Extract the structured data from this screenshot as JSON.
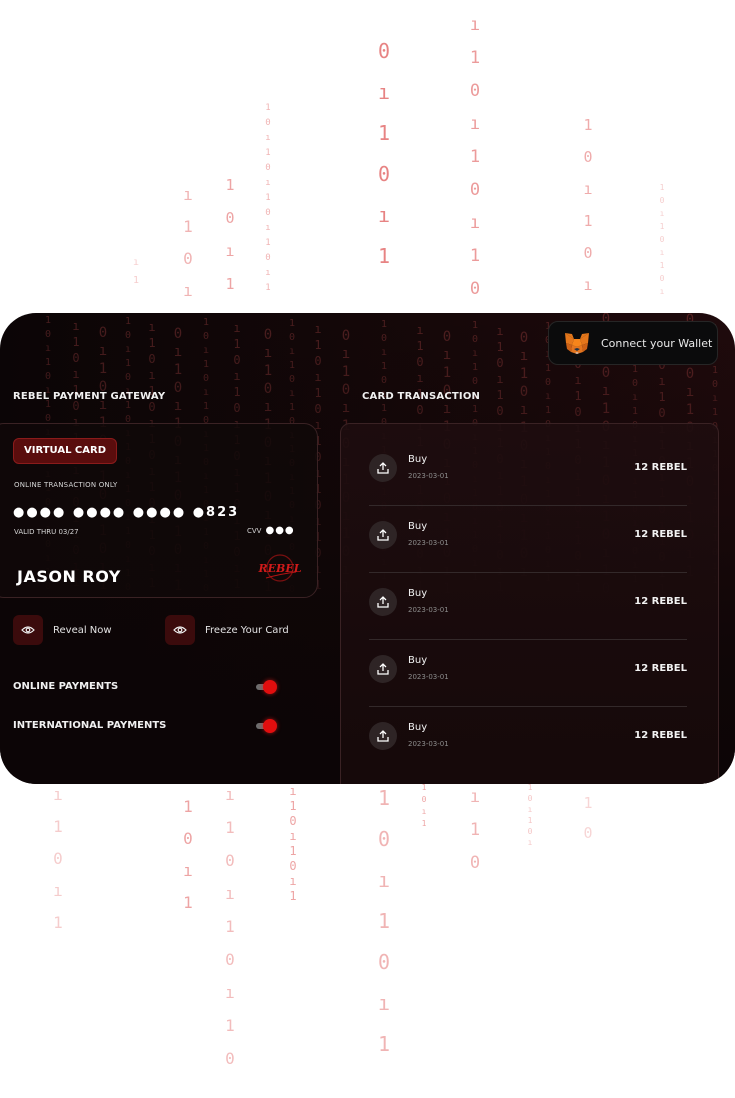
{
  "header": {
    "wallet_button": "Connect your Wallet",
    "wallet_icon": "metamask-fox-icon"
  },
  "sections": {
    "gateway_title": "REBEL PAYMENT GATEWAY",
    "transactions_title": "CARD TRANSACTION"
  },
  "card": {
    "badge": "VIRTUAL CARD",
    "online_only": "ONLINE TRANSACTION ONLY",
    "number": "●●●● ●●●● ●●●● ●823",
    "valid_thru": "VALID THRU 03/27",
    "cvv_label": "CVV",
    "cvv_value": "●●●",
    "holder_name": "JASON ROY",
    "brand_logo_text": "REBEL"
  },
  "actions": {
    "reveal": "Reveal Now",
    "freeze": "Freeze Your Card",
    "icon": "eye-icon"
  },
  "toggles": [
    {
      "label": "ONLINE PAYMENTS",
      "enabled": true
    },
    {
      "label": "INTERNATIONAL PAYMENTS",
      "enabled": true
    }
  ],
  "transactions": [
    {
      "type": "Buy",
      "date": "2023-03-01",
      "amount": "12 REBEL",
      "icon": "upload-icon"
    },
    {
      "type": "Buy",
      "date": "2023-03-01",
      "amount": "12 REBEL",
      "icon": "upload-icon"
    },
    {
      "type": "Buy",
      "date": "2023-03-01",
      "amount": "12 REBEL",
      "icon": "upload-icon"
    },
    {
      "type": "Buy",
      "date": "2023-03-01",
      "amount": "12 REBEL",
      "icon": "upload-icon"
    },
    {
      "type": "Buy",
      "date": "2023-03-01",
      "amount": "12 REBEL",
      "icon": "upload-icon"
    }
  ],
  "colors": {
    "accent_red": "#e10e0e",
    "badge_bg": "#5a0d0d",
    "panel_bg": "#130708",
    "rain": "#e05a5a"
  }
}
